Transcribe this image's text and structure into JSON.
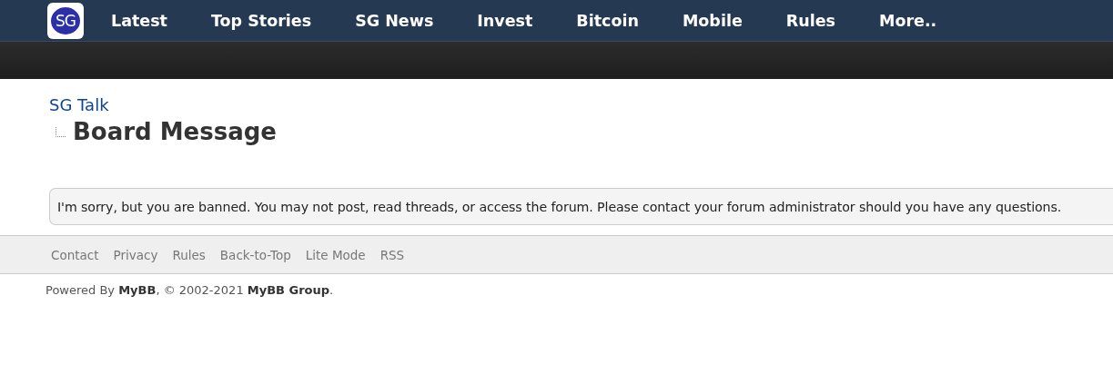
{
  "logo": {
    "text": "SG"
  },
  "nav": [
    {
      "label": "Latest"
    },
    {
      "label": "Top Stories"
    },
    {
      "label": "SG News"
    },
    {
      "label": "Invest"
    },
    {
      "label": "Bitcoin"
    },
    {
      "label": "Mobile"
    },
    {
      "label": "Rules"
    },
    {
      "label": "More.."
    }
  ],
  "breadcrumb": {
    "parent": "SG Talk",
    "current": "Board Message"
  },
  "message": "I'm sorry, but you are banned. You may not post, read threads, or access the forum. Please contact your forum administrator should you have any questions.",
  "footer_links": [
    "Contact",
    "Privacy",
    "Rules",
    "Back-to-Top",
    "Lite Mode",
    "RSS"
  ],
  "copyright": "Powered By **MyBB**, © 2002-2021 **MyBB Group**."
}
